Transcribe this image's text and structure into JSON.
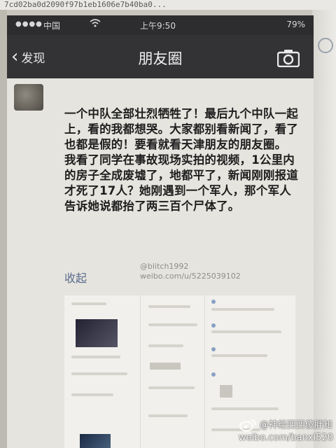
{
  "browser": {
    "url_fragment": "7cd02ba0d2090f97b1eb1606e7b40ba0..."
  },
  "statusbar": {
    "dots": "●●●●",
    "carrier": "中国",
    "time": "上午9:50",
    "battery": "79%"
  },
  "navbar": {
    "back_label": "发现",
    "title": "朋友圈"
  },
  "post": {
    "paragraphs": [
      "一个中队全部壮烈牺牲了！最后九个中队一起上，看的我都想哭。大家都别看新闻了，看了也都是假的！要看就看天津朋友的朋友圈。",
      "我看了同学在事故现场实拍的视频，1公里内的房子全成废墟了，地都平了，新闻刚刚报道才死了17人？她刚遇到一个军人，那个军人告诉她说都抬了两三百个尸体了。"
    ],
    "collapse_label": "收起",
    "watermark_line1": "@blitch1992",
    "watermark_line2": "weibo.com/u/5225039102"
  },
  "weibo_watermark": {
    "handle": "@神经西西傻胖知",
    "url": "weibo.com/banxi520"
  },
  "colors": {
    "navbar": "#333336",
    "link": "#5a6d8e"
  }
}
